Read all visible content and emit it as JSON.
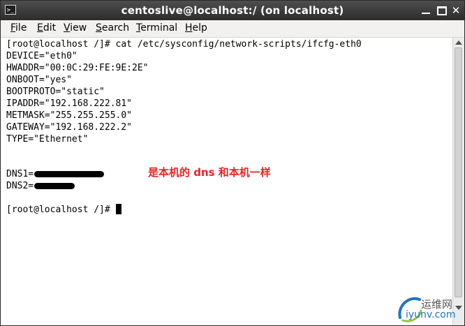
{
  "window": {
    "title": "centoslive@localhost:/ (on localhost)"
  },
  "menu": [
    {
      "accel": "F",
      "rest": "ile"
    },
    {
      "accel": "E",
      "rest": "dit"
    },
    {
      "accel": "V",
      "rest": "iew"
    },
    {
      "accel": "S",
      "rest": "earch"
    },
    {
      "accel": "T",
      "rest": "erminal"
    },
    {
      "accel": "H",
      "rest": "elp"
    }
  ],
  "terminal": {
    "lines": [
      "[root@localhost /]# cat /etc/sysconfig/network-scripts/ifcfg-eth0",
      "DEVICE=\"eth0\"",
      "HWADDR=\"00:0C:29:FE:9E:2E\"",
      "ONBOOT=\"yes\"",
      "BOOTPROTO=\"static\"",
      "IPADDR=\"192.168.222.81\"",
      "METMASK=\"255.255.255.0\"",
      "GATEWAY=\"192.168.222.2\"",
      "TYPE=\"Ethernet\""
    ],
    "dns1_label": "DNS1=",
    "dns2_label": "DNS2=",
    "prompt": "[root@localhost /]# "
  },
  "annotation": {
    "text": "是本机的 dns 和本机一样",
    "color": "#ee2222"
  },
  "watermark": {
    "brand": "运维网",
    "site": "iyunv.com"
  }
}
